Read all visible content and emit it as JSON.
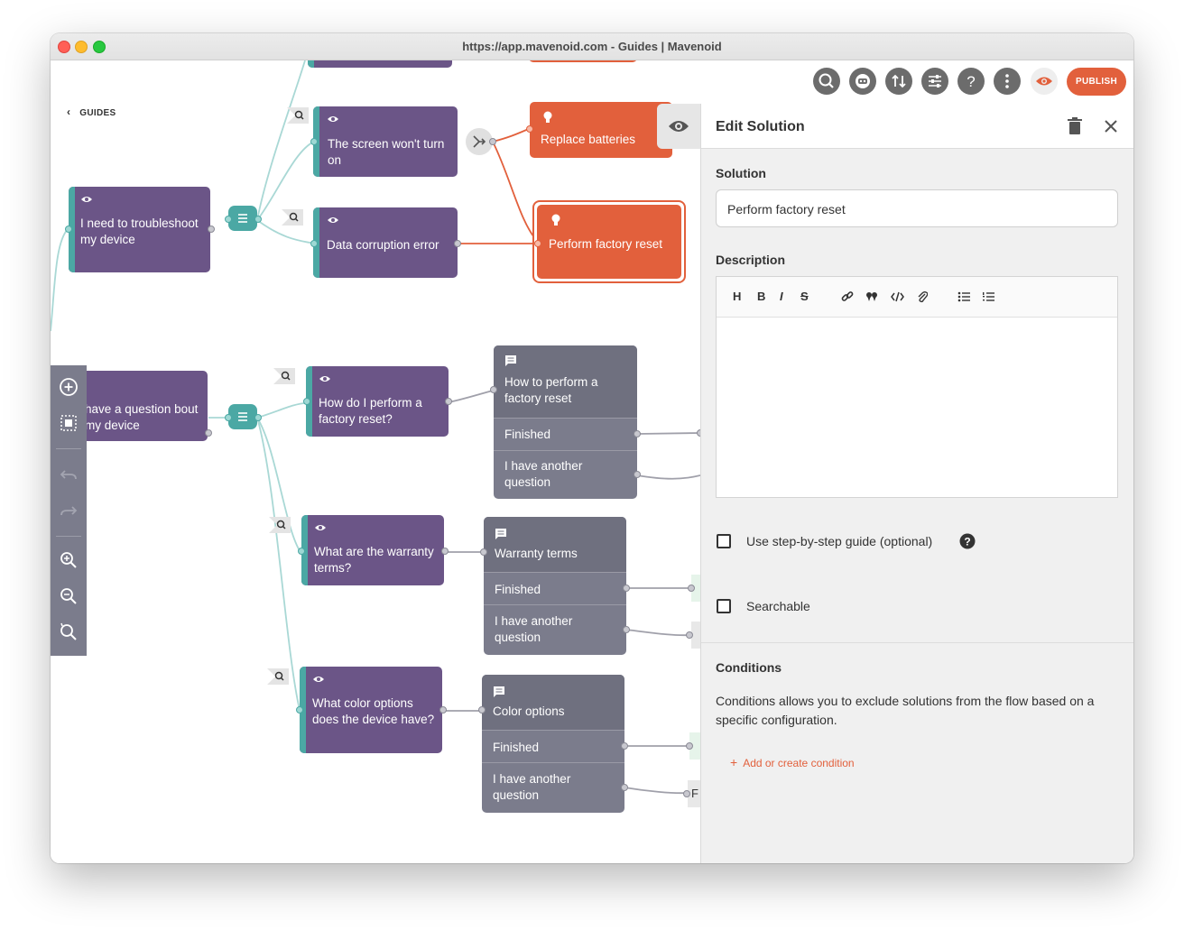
{
  "window": {
    "title": "https://app.mavenoid.com - Guides | Mavenoid"
  },
  "nav": {
    "back_label": "GUIDES"
  },
  "toolbar": {
    "publish_label": "PUBLISH",
    "icons": [
      "search-icon",
      "bot-icon",
      "sort-icon",
      "settings-sliders-icon",
      "help-icon",
      "more-icon",
      "preview-eye-icon"
    ]
  },
  "left_tools": [
    "add-node-icon",
    "select-area-icon",
    "undo-icon",
    "redo-icon",
    "zoom-in-icon",
    "zoom-out-icon",
    "zoom-reset-icon"
  ],
  "canvas": {
    "nodes": {
      "troubleshoot": "I need to troubleshoot my device",
      "screen": "The screen won't turn on",
      "corruption": "Data corruption error",
      "replace": "Replace batteries",
      "factory_reset": "Perform factory reset",
      "question": "have a question bout my device",
      "how_reset": "How do I perform a factory reset?",
      "warranty_q": "What are the warranty terms?",
      "color_q": "What color options does the device have?"
    },
    "responses": {
      "r1": {
        "title": "How to perform a factory reset",
        "opt1": "Finished",
        "opt2": "I have another question"
      },
      "r2": {
        "title": "Warranty terms",
        "opt1": "Finished",
        "opt2": "I have another question"
      },
      "r3": {
        "title": "Color options",
        "opt1": "Finished",
        "opt2": "I have another question"
      }
    },
    "partial_label": "F"
  },
  "panel": {
    "title": "Edit Solution",
    "solution_label": "Solution",
    "solution_value": "Perform factory reset",
    "description_label": "Description",
    "editor_buttons": [
      "H",
      "B",
      "I",
      "S"
    ],
    "step_guide_label": "Use step-by-step guide (optional)",
    "searchable_label": "Searchable",
    "conditions_label": "Conditions",
    "conditions_text": "Conditions allows you to exclude solutions from the flow based on a specific configuration.",
    "add_condition_label": "Add or create condition"
  },
  "colors": {
    "accent": "#e2603c",
    "question": "#6b5587",
    "teal": "#4ba8a4",
    "response": "#7b7c8c"
  }
}
